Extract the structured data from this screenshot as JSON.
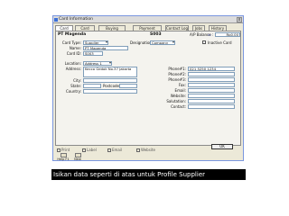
{
  "window": {
    "title": "Card Information",
    "close_glyph": "x"
  },
  "tabs": [
    {
      "label": "Card Info"
    },
    {
      "label": "Card Details"
    },
    {
      "label": "Buying Details"
    },
    {
      "label": "Payment Details"
    },
    {
      "label": "Contact Log"
    },
    {
      "label": "Jobs"
    },
    {
      "label": "History"
    }
  ],
  "header": {
    "card_name": "PT Magenda",
    "card_code": "S003",
    "balance_label": "A/P Balance :",
    "balance_value": "Rp0,00"
  },
  "form": {
    "card_type_label": "Card Type:",
    "card_type_value": "Supplier",
    "designation_label": "Designation:",
    "designation_value": "Company",
    "inactive_label": "Inactive Card",
    "name_label": "Name:",
    "name_value": "PT Magenda",
    "card_id_label": "Card ID:",
    "card_id_value": "S003",
    "location_label": "Location:",
    "location_value": "Address 1",
    "address_label": "Address:",
    "address_value": "Kecco Gedok No.37 Jakarta",
    "city_label": "City:",
    "state_label": "State:",
    "postcode_label": "Postcode:",
    "country_label": "Country:",
    "phone1_label": "Phone#1:",
    "phone1_value": "021 5250 1234",
    "phone2_label": "Phone#2:",
    "phone3_label": "Phone#3:",
    "fax_label": "Fax:",
    "email_label": "Email:",
    "website_label": "Website:",
    "salutation_label": "Salutation:",
    "contact_label": "Contact:"
  },
  "toolbar": {
    "print": "Print",
    "label": "Label",
    "email": "Email",
    "website": "Website"
  },
  "bottom": {
    "help_label": "Help F1",
    "new_label": "New",
    "ok_label": "OK"
  },
  "caption": "Isikan data seperti di atas untuk Profile Supplier"
}
